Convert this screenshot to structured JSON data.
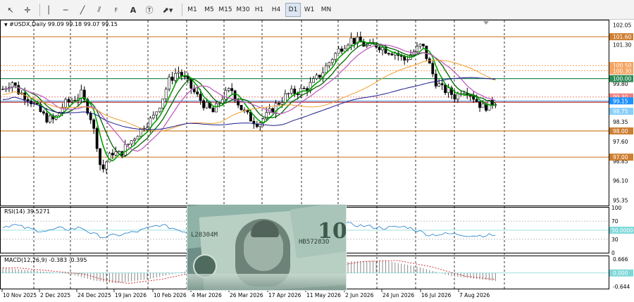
{
  "toolbar": {
    "tools": [
      "cursor-icon",
      "crosshair-icon",
      "vertical-line-icon",
      "horizontal-line-icon",
      "trendline-icon",
      "equidistant-channel-icon",
      "fibonacci-icon",
      "text-icon",
      "text-label-icon",
      "arrows-icon"
    ],
    "timeframes": [
      "M1",
      "M5",
      "M15",
      "M30",
      "H1",
      "H4",
      "D1",
      "W1",
      "MN"
    ],
    "active_timeframe": "D1"
  },
  "chart": {
    "symbol_line": "#USDX,Daily  99.09 99.18 99.07 99.15",
    "price_labels": [
      "102.05",
      "101.60",
      "101.30",
      "100.50",
      "100.30",
      "100.00",
      "99.80",
      "99.30",
      "99.15",
      "98.75",
      "98.35",
      "98.00",
      "97.60",
      "97.00",
      "96.85",
      "96.10",
      "95.35"
    ],
    "level_lines": [
      {
        "price": "101.60",
        "color": "#cd7f32"
      },
      {
        "price": "100.00",
        "color": "#2e8b57"
      },
      {
        "price": "98.00",
        "color": "#cd7f32"
      },
      {
        "price": "97.00",
        "color": "#cd7f32"
      }
    ],
    "dotted_levels": [
      {
        "price": "100.50",
        "color": "#f4a460"
      },
      {
        "price": "100.30",
        "color": "#f4a460"
      },
      {
        "price": "99.30",
        "color": "#f08080"
      }
    ],
    "tagged_labels": [
      {
        "price": "101.60",
        "bg": "#cd7f32"
      },
      {
        "price": "100.50",
        "bg": "#f4a460"
      },
      {
        "price": "100.30",
        "bg": "#f4a460"
      },
      {
        "price": "100.00",
        "bg": "#2e8b57"
      },
      {
        "price": "99.30",
        "bg": "#f08080"
      },
      {
        "price": "99.15",
        "bg": "#1e90ff"
      },
      {
        "price": "98.75",
        "bg": "#87cefa"
      },
      {
        "price": "98.00",
        "bg": "#cd7f32"
      },
      {
        "price": "97.00",
        "bg": "#cd7f32"
      }
    ]
  },
  "rsi": {
    "title": "RSI(14) 39.5271",
    "labels": [
      "100",
      "70",
      "50.0000",
      "30",
      "0"
    ]
  },
  "macd": {
    "title": "MACD(12,26,9) -0.383 -0.395",
    "labels": [
      "0.666",
      "0.000",
      "-0.644"
    ]
  },
  "date_axis": [
    "10 Nov 2025",
    "2 Dec 2025",
    "24 Dec 2025",
    "19 Jan 2026",
    "10 Feb 2026",
    "4 Mar 2026",
    "26 Mar 2026",
    "17 Apr 2026",
    "11 May 2026",
    "2 Jun 2026",
    "24 Jun 2026",
    "16 Jul 2026",
    "7 Aug 2026"
  ],
  "colors": {
    "bull_candle": "#000000",
    "bear_candle": "#000000",
    "ma_green": "#00a000",
    "ma_dark_green": "#006400",
    "ma_violet": "#c060c0",
    "ma_orange": "#f0a030",
    "ma_blue": "#1a1a8c",
    "ma_red": "#b22222",
    "rsi_line": "#1e7bc8",
    "macd_signal": "#d02020"
  }
}
